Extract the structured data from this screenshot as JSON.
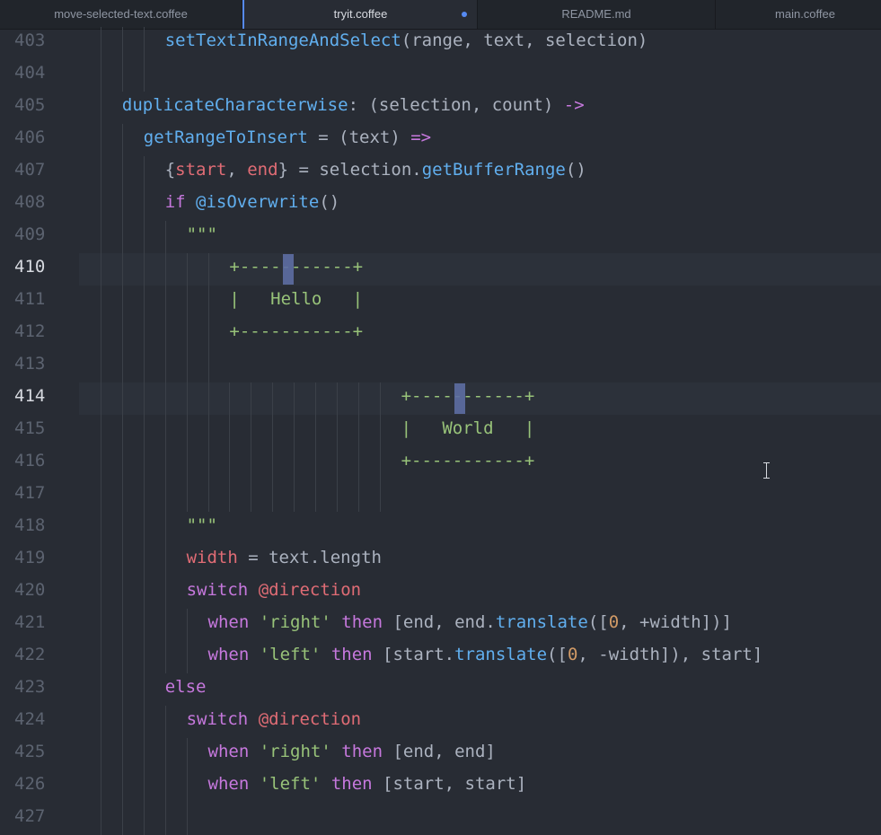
{
  "tabs": [
    {
      "label": "move-selected-text.coffee",
      "active": false,
      "modified": false
    },
    {
      "label": "tryit.coffee",
      "active": true,
      "modified": true
    },
    {
      "label": "README.md",
      "active": false,
      "modified": false
    },
    {
      "label": "main.coffee",
      "active": false,
      "modified": false
    }
  ],
  "colors": {
    "background": "#282c34",
    "gutter_text": "#5c6370",
    "function": "#61afef",
    "keyword": "#c678dd",
    "variable": "#e06c75",
    "string": "#98c379",
    "number": "#d19a66",
    "text": "#abb2bf",
    "modified_dot": "#568af2"
  },
  "cursor_lines": [
    410,
    414
  ],
  "lines": [
    {
      "n": "403",
      "indent": 3,
      "tokens": [
        [
          "fn",
          "setTextInRangeAndSelect"
        ],
        [
          "txt",
          "(range, text, selection)"
        ]
      ]
    },
    {
      "n": "404",
      "indent": 0,
      "tokens": []
    },
    {
      "n": "405",
      "indent": 1,
      "tokens": [
        [
          "fn",
          "duplicateCharacterwise"
        ],
        [
          "txt",
          ": (selection, count) "
        ],
        [
          "kw",
          "->"
        ]
      ]
    },
    {
      "n": "406",
      "indent": 2,
      "tokens": [
        [
          "fn",
          "getRangeToInsert"
        ],
        [
          "txt",
          " = (text) "
        ],
        [
          "kw",
          "=>"
        ]
      ]
    },
    {
      "n": "407",
      "indent": 3,
      "tokens": [
        [
          "txt",
          "{"
        ],
        [
          "var",
          "start"
        ],
        [
          "txt",
          ", "
        ],
        [
          "var",
          "end"
        ],
        [
          "txt",
          "} = selection."
        ],
        [
          "fn",
          "getBufferRange"
        ],
        [
          "txt",
          "()"
        ]
      ]
    },
    {
      "n": "408",
      "indent": 3,
      "tokens": [
        [
          "kw",
          "if"
        ],
        [
          "txt",
          " "
        ],
        [
          "fn",
          "@isOverwrite"
        ],
        [
          "txt",
          "()"
        ]
      ]
    },
    {
      "n": "409",
      "indent": 4,
      "tokens": [
        [
          "str",
          "\"\"\""
        ]
      ]
    },
    {
      "n": "410",
      "indent": 6,
      "tokens": [
        [
          "str",
          "+-----------+"
        ]
      ]
    },
    {
      "n": "411",
      "indent": 6,
      "tokens": [
        [
          "str",
          "|   Hello   |"
        ]
      ]
    },
    {
      "n": "412",
      "indent": 6,
      "tokens": [
        [
          "str",
          "+-----------+"
        ]
      ]
    },
    {
      "n": "413",
      "indent": 0,
      "tokens": []
    },
    {
      "n": "414",
      "indent": 14,
      "tokens": [
        [
          "str",
          "+-----------+"
        ]
      ]
    },
    {
      "n": "415",
      "indent": 14,
      "tokens": [
        [
          "str",
          "|   World   |"
        ]
      ]
    },
    {
      "n": "416",
      "indent": 14,
      "tokens": [
        [
          "str",
          "+-----------+"
        ]
      ]
    },
    {
      "n": "417",
      "indent": 0,
      "tokens": []
    },
    {
      "n": "418",
      "indent": 4,
      "tokens": [
        [
          "str",
          "\"\"\""
        ]
      ]
    },
    {
      "n": "419",
      "indent": 4,
      "tokens": [
        [
          "var",
          "width"
        ],
        [
          "txt",
          " = text.length"
        ]
      ]
    },
    {
      "n": "420",
      "indent": 4,
      "tokens": [
        [
          "kw",
          "switch"
        ],
        [
          "txt",
          " "
        ],
        [
          "var",
          "@direction"
        ]
      ]
    },
    {
      "n": "421",
      "indent": 5,
      "tokens": [
        [
          "kw",
          "when"
        ],
        [
          "txt",
          " "
        ],
        [
          "str",
          "'right'"
        ],
        [
          "txt",
          " "
        ],
        [
          "kw",
          "then"
        ],
        [
          "txt",
          " [end, end."
        ],
        [
          "fn",
          "translate"
        ],
        [
          "txt",
          "(["
        ],
        [
          "num",
          "0"
        ],
        [
          "txt",
          ", +width])]"
        ]
      ]
    },
    {
      "n": "422",
      "indent": 5,
      "tokens": [
        [
          "kw",
          "when"
        ],
        [
          "txt",
          " "
        ],
        [
          "str",
          "'left'"
        ],
        [
          "txt",
          " "
        ],
        [
          "kw",
          "then"
        ],
        [
          "txt",
          " [start."
        ],
        [
          "fn",
          "translate"
        ],
        [
          "txt",
          "(["
        ],
        [
          "num",
          "0"
        ],
        [
          "txt",
          ", -width]), start]"
        ]
      ]
    },
    {
      "n": "423",
      "indent": 3,
      "tokens": [
        [
          "kw",
          "else"
        ]
      ]
    },
    {
      "n": "424",
      "indent": 4,
      "tokens": [
        [
          "kw",
          "switch"
        ],
        [
          "txt",
          " "
        ],
        [
          "var",
          "@direction"
        ]
      ]
    },
    {
      "n": "425",
      "indent": 5,
      "tokens": [
        [
          "kw",
          "when"
        ],
        [
          "txt",
          " "
        ],
        [
          "str",
          "'right'"
        ],
        [
          "txt",
          " "
        ],
        [
          "kw",
          "then"
        ],
        [
          "txt",
          " [end, end]"
        ]
      ]
    },
    {
      "n": "426",
      "indent": 5,
      "tokens": [
        [
          "kw",
          "when"
        ],
        [
          "txt",
          " "
        ],
        [
          "str",
          "'left'"
        ],
        [
          "txt",
          " "
        ],
        [
          "kw",
          "then"
        ],
        [
          "txt",
          " [start, start]"
        ]
      ]
    },
    {
      "n": "427",
      "indent": 0,
      "tokens": []
    }
  ]
}
